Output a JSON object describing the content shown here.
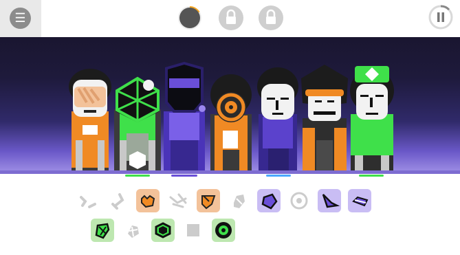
{
  "topbar": {
    "menu_icon": "hamburger-menu-icon",
    "bonus_icons": [
      "progress-ring-icon",
      "lock-icon",
      "lock-icon"
    ],
    "pause_icon": "pause-icon",
    "progress_fraction": 0.15,
    "progress_color": "#f5a623"
  },
  "stage": {
    "characters": [
      {
        "name": "character-1",
        "theme": "orange",
        "active": false
      },
      {
        "name": "character-2",
        "theme": "green",
        "active": true
      },
      {
        "name": "character-3",
        "theme": "purple",
        "active": true
      },
      {
        "name": "character-4",
        "theme": "orange",
        "active": false
      },
      {
        "name": "character-5",
        "theme": "purple",
        "active": true
      },
      {
        "name": "character-6",
        "theme": "orange",
        "active": false
      },
      {
        "name": "character-7",
        "theme": "green",
        "active": true
      }
    ]
  },
  "sound_icons": {
    "row1": [
      {
        "name": "beat-icon-1",
        "category": "beat",
        "selected": false
      },
      {
        "name": "beat-icon-2",
        "category": "beat",
        "selected": false
      },
      {
        "name": "effect-icon-1",
        "category": "effect",
        "selected": true
      },
      {
        "name": "effect-icon-2",
        "category": "effect",
        "selected": false
      },
      {
        "name": "effect-icon-3",
        "category": "effect",
        "selected": true
      },
      {
        "name": "effect-icon-4",
        "category": "effect",
        "selected": false
      },
      {
        "name": "melody-icon-1",
        "category": "melody",
        "selected": true
      },
      {
        "name": "melody-icon-2",
        "category": "melody",
        "selected": false
      },
      {
        "name": "melody-icon-3",
        "category": "melody",
        "selected": true
      },
      {
        "name": "melody-icon-4",
        "category": "melody",
        "selected": true
      }
    ],
    "row2": [
      {
        "name": "voice-icon-1",
        "category": "voice",
        "selected": true
      },
      {
        "name": "voice-icon-2",
        "category": "voice",
        "selected": false
      },
      {
        "name": "voice-icon-3",
        "category": "voice",
        "selected": true
      },
      {
        "name": "voice-icon-4",
        "category": "voice",
        "selected": false
      },
      {
        "name": "voice-icon-5",
        "category": "voice",
        "selected": true
      }
    ]
  },
  "colors": {
    "orange": "#f08a24",
    "purple": "#6a4fd8",
    "green": "#3fe04a",
    "beat_gray": "#cccccc"
  }
}
